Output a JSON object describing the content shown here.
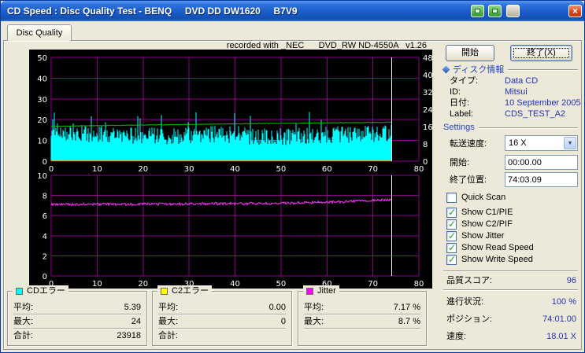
{
  "colors": {
    "grid": "#8B008B",
    "c1_area": "#00FFFF",
    "c2_line": "#C8C800",
    "speed_line": "#00BE00",
    "jitter_line": "#FF30FF",
    "cursor": "#FFFFFF",
    "value_blue": "#2233BB",
    "header_blue": "#2244CC"
  },
  "icons": {
    "close": "×",
    "combo_arrow": "▼",
    "check": "✓"
  },
  "window": {
    "title": "CD Speed : Disc Quality Test - BENQ     DVD DD DW1620     B7V9"
  },
  "tabs": [
    {
      "label": "Disc Quality"
    }
  ],
  "recorded_with": "recorded with _NEC      DVD_RW ND-4550A   v1.26",
  "actions": {
    "start": "開始",
    "exit": "終了(X)"
  },
  "disc_info": {
    "title": "ディスク情報",
    "rows": [
      {
        "label": "タイプ:",
        "value": "Data CD"
      },
      {
        "label": "ID:",
        "value": "Mitsui"
      },
      {
        "label": "日付:",
        "value": "10 September 2005"
      },
      {
        "label": "Label:",
        "value": "CDS_TEST_A2"
      }
    ]
  },
  "settings": {
    "title": "Settings",
    "speed_label": "転送速度:",
    "speed_value": "16 X",
    "start_label": "開始:",
    "start_value": "00:00.00",
    "end_label": "終了位置:",
    "end_value": "74:03.09",
    "checkboxes": [
      {
        "label": "Quick Scan",
        "checked": false
      },
      {
        "label": "Show C1/PIE",
        "checked": true
      },
      {
        "label": "Show C2/PIF",
        "checked": true
      },
      {
        "label": "Show Jitter",
        "checked": true
      },
      {
        "label": "Show Read Speed",
        "checked": true
      },
      {
        "label": "Show Write Speed",
        "checked": true
      }
    ]
  },
  "quality": {
    "label": "品質スコア:",
    "value": "96"
  },
  "status": [
    {
      "label": "進行状況:",
      "value": "100 %"
    },
    {
      "label": "ポジション:",
      "value": "74:01.00"
    },
    {
      "label": "速度:",
      "value": "18.01 X"
    }
  ],
  "legend_boxes": [
    {
      "title": "CDエラー",
      "color": "#00FFFF",
      "rows": [
        {
          "label": "平均:",
          "value": "5.39"
        },
        {
          "label": "最大:",
          "value": "24"
        },
        {
          "label": "合計:",
          "value": "23918"
        }
      ]
    },
    {
      "title": "C2エラー",
      "color": "#FFFF00",
      "rows": [
        {
          "label": "平均:",
          "value": "0.00"
        },
        {
          "label": "最大:",
          "value": "0"
        },
        {
          "label": "合計:",
          "value": ""
        }
      ]
    },
    {
      "title": "Jitter",
      "color": "#FF00FF",
      "rows": [
        {
          "label": "平均:",
          "value": "7.17 %"
        },
        {
          "label": "最大:",
          "value": "8.7 %"
        },
        {
          "label": "",
          "value": ""
        }
      ]
    }
  ],
  "chart_data": [
    {
      "type": "area",
      "x_range": [
        0,
        80
      ],
      "x_ticks": [
        0,
        10,
        20,
        30,
        40,
        50,
        60,
        70,
        80
      ],
      "y_left": {
        "range": [
          0,
          50
        ],
        "ticks": [
          0,
          10,
          20,
          30,
          40,
          50
        ]
      },
      "y_right": {
        "range": [
          0,
          48
        ],
        "ticks": [
          0,
          8,
          16,
          24,
          32,
          40,
          48
        ]
      },
      "cursor_x": 74.05,
      "series": [
        {
          "name": "CDエラー (C1/PIE)",
          "axis": "left",
          "style": "spiky-area",
          "color": "#00FFFF",
          "x_end": 74.05,
          "seed": 12,
          "noise": 4.2,
          "spike_prob": 0.055,
          "spike_max": 24,
          "envelope": [
            [
              0,
              14
            ],
            [
              4,
              14
            ],
            [
              8,
              13
            ],
            [
              15,
              12.5
            ],
            [
              22,
              12
            ],
            [
              30,
              12.5
            ],
            [
              34,
              13.5
            ],
            [
              42,
              12
            ],
            [
              50,
              12
            ],
            [
              58,
              12.5
            ],
            [
              66,
              13
            ],
            [
              74,
              13.5
            ]
          ],
          "stats": {
            "avg": 5.39,
            "max": 24,
            "total": 23918
          }
        },
        {
          "name": "C2エラー (C2/PIF)",
          "axis": "left",
          "style": "flat",
          "color": "#C8C800",
          "x_end": 74.05,
          "value": 0.25,
          "stats": {
            "avg": 0.0,
            "max": 0
          }
        },
        {
          "name": "Read Speed",
          "axis": "right",
          "style": "line",
          "color": "#00BE00",
          "x_end": 74.05,
          "seed": 5,
          "noise": 0.15,
          "envelope": [
            [
              0,
              16.1
            ],
            [
              15,
              16.6
            ],
            [
              30,
              17.0
            ],
            [
              45,
              17.4
            ],
            [
              60,
              17.7
            ],
            [
              74,
              18.0
            ]
          ],
          "stats": {
            "end_speed_x": 18.01
          }
        }
      ]
    },
    {
      "type": "line",
      "x_range": [
        0,
        80
      ],
      "x_ticks": [
        0,
        10,
        20,
        30,
        40,
        50,
        60,
        70,
        80
      ],
      "y_left": {
        "range": [
          0,
          10
        ],
        "ticks": [
          0,
          2,
          4,
          6,
          8,
          10
        ]
      },
      "cursor_x": 74.05,
      "series": [
        {
          "name": "Jitter",
          "axis": "left",
          "style": "line",
          "color": "#FF30FF",
          "x_end": 74.05,
          "seed": 9,
          "noise": 0.13,
          "envelope": [
            [
              0,
              7.1
            ],
            [
              12,
              7.12
            ],
            [
              25,
              7.15
            ],
            [
              38,
              7.18
            ],
            [
              48,
              7.2
            ],
            [
              55,
              7.28
            ],
            [
              62,
              7.35
            ],
            [
              68,
              7.45
            ],
            [
              72,
              7.55
            ],
            [
              74,
              7.6
            ]
          ],
          "stats": {
            "avg_pct": 7.17,
            "max_pct": 8.7
          }
        }
      ]
    }
  ]
}
